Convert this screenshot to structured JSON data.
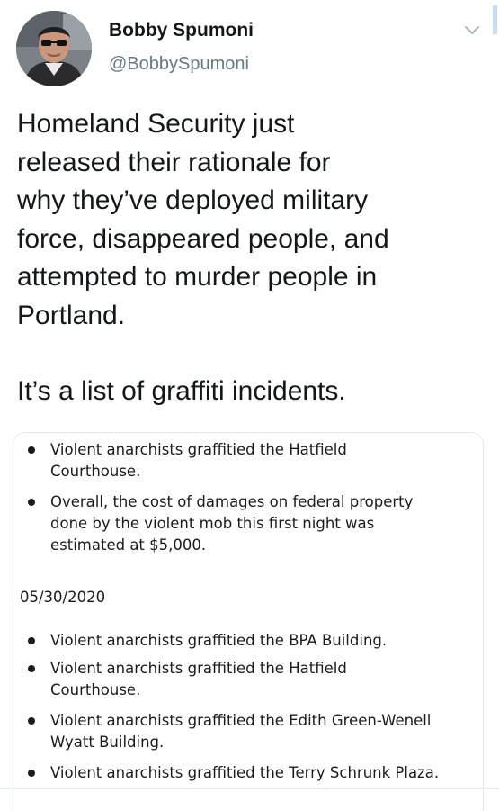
{
  "user": {
    "display_name": "Bobby Spumoni",
    "handle": "@BobbySpumoni"
  },
  "tweet": {
    "paragraphs": [
      "Homeland Security just\nreleased their rationale for\nwhy they’ve deployed military\nforce, disappeared people, and\nattempted to murder people in\nPortland.",
      "It’s a list of graffiti incidents."
    ]
  },
  "attached_image": {
    "bullets_first_night": [
      "Violent anarchists graffitied the Hatfield\nCourthouse.",
      "Overall, the cost of damages on federal property\ndone by the violent mob this first night was\nestimated at $5,000."
    ],
    "date_heading": "05/30/2020",
    "bullets_0530": [
      "Violent anarchists graffitied the BPA Building.",
      "Violent anarchists graffitied the Hatfield\nCourthouse.",
      "Violent anarchists graffitied the Edith Green-Wenell\nWyatt Building.",
      "Violent anarchists graffitied the Terry Schrunk Plaza."
    ]
  },
  "icons": {
    "more_menu": "chevron-down-icon"
  },
  "colors": {
    "text": "#14171a",
    "secondary_text": "#657786",
    "card_border": "#e1e8ed"
  }
}
